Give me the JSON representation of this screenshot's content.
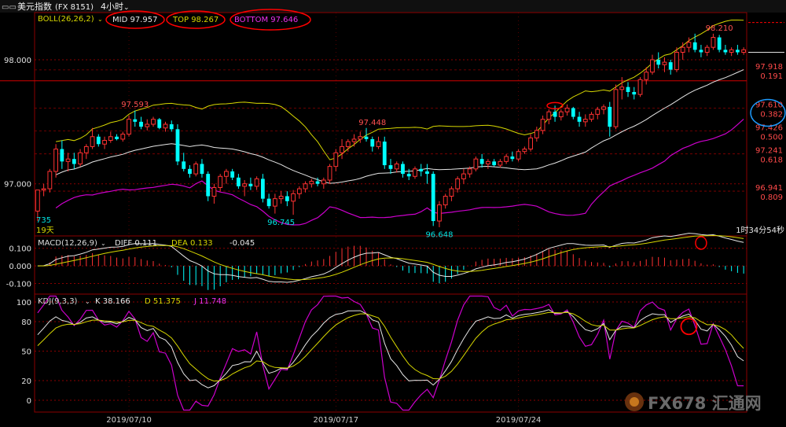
{
  "titlebar": {
    "symbol": "美元指数",
    "code": "(FX 8151)",
    "period": "4小时"
  },
  "boll": {
    "label": "BOLL(26,26,2)",
    "mid_label": "MID 97.957",
    "top_label": "TOP 98.267",
    "bottom_label": "BOTTOM 97.646"
  },
  "macd": {
    "label": "MACD(12,26,9)",
    "diff_label": "DIFF 0.111",
    "dea_label": "DEA 0.133",
    "macd_value": "-0.045"
  },
  "kdj": {
    "label": "KDJ(9,3,3)",
    "k_label": "K 38.166",
    "d_label": "D 51.375",
    "j_label": "J 11.748"
  },
  "countdown": "1时34分54秒",
  "left_marks": {
    "low_fragment": "735",
    "days": "19天"
  },
  "watermark": "FX678 汇通网",
  "colors": {
    "up": "#ff3232",
    "down": "#00ffff",
    "mid": "#e6e6e6",
    "top": "#d7d700",
    "bottom": "#cc00cc",
    "grid": "#8b0000",
    "annot": "#ff0000"
  },
  "chart_data": [
    {
      "type": "candlestick",
      "title": "美元指数 4小时",
      "y_ticks": [
        "98.000",
        "97.000"
      ],
      "y_tick_values": [
        98.0,
        97.0
      ],
      "ylim": [
        96.58,
        98.38
      ],
      "x_dates": [
        "2019/07/10",
        "2019/07/17",
        "2019/07/24"
      ],
      "fib_levels": [
        {
          "price": 97.918,
          "ratio": 0.191
        },
        {
          "price": 97.61,
          "ratio": 0.382
        },
        {
          "price": 97.426,
          "ratio": 0.5
        },
        {
          "price": 97.241,
          "ratio": 0.618
        },
        {
          "price": 96.941,
          "ratio": 0.809
        }
      ],
      "annotations": [
        {
          "text": "97.593",
          "price": 97.593
        },
        {
          "text": "96.745",
          "price": 96.745
        },
        {
          "text": "97.448",
          "price": 97.448
        },
        {
          "text": "96.648",
          "price": 96.648
        },
        {
          "text": "98.210",
          "price": 98.21
        }
      ],
      "candles": [
        [
          96.78,
          96.95,
          96.7,
          96.95
        ],
        [
          96.95,
          97.0,
          96.9,
          96.96
        ],
        [
          96.96,
          97.12,
          96.93,
          97.1
        ],
        [
          97.1,
          97.32,
          97.05,
          97.28
        ],
        [
          97.28,
          97.35,
          97.12,
          97.18
        ],
        [
          97.18,
          97.25,
          97.1,
          97.2
        ],
        [
          97.2,
          97.25,
          97.12,
          97.16
        ],
        [
          97.16,
          97.28,
          97.14,
          97.25
        ],
        [
          97.25,
          97.32,
          97.2,
          97.3
        ],
        [
          97.3,
          97.45,
          97.28,
          97.38
        ],
        [
          97.38,
          97.4,
          97.3,
          97.32
        ],
        [
          97.32,
          97.38,
          97.28,
          97.35
        ],
        [
          97.35,
          97.42,
          97.33,
          97.38
        ],
        [
          97.38,
          97.4,
          97.35,
          97.36
        ],
        [
          97.36,
          97.42,
          97.34,
          97.4
        ],
        [
          97.4,
          97.55,
          97.38,
          97.52
        ],
        [
          97.52,
          97.59,
          97.46,
          97.5
        ],
        [
          97.5,
          97.54,
          97.44,
          97.46
        ],
        [
          97.46,
          97.52,
          97.43,
          97.48
        ],
        [
          97.48,
          97.54,
          97.46,
          97.52
        ],
        [
          97.52,
          97.53,
          97.44,
          97.45
        ],
        [
          97.45,
          97.5,
          97.42,
          97.48
        ],
        [
          97.48,
          97.51,
          97.42,
          97.44
        ],
        [
          97.44,
          97.48,
          97.15,
          97.18
        ],
        [
          97.18,
          97.25,
          97.1,
          97.12
        ],
        [
          97.12,
          97.15,
          97.05,
          97.08
        ],
        [
          97.08,
          97.18,
          97.06,
          97.16
        ],
        [
          97.16,
          97.2,
          97.05,
          97.08
        ],
        [
          97.08,
          97.1,
          96.86,
          96.9
        ],
        [
          96.9,
          97.0,
          96.84,
          96.97
        ],
        [
          96.97,
          97.08,
          96.94,
          97.06
        ],
        [
          97.06,
          97.12,
          97.0,
          97.1
        ],
        [
          97.1,
          97.12,
          97.03,
          97.05
        ],
        [
          97.05,
          97.08,
          96.96,
          96.98
        ],
        [
          96.98,
          97.03,
          96.9,
          97.0
        ],
        [
          97.0,
          97.05,
          96.95,
          96.98
        ],
        [
          96.98,
          97.06,
          96.95,
          97.04
        ],
        [
          97.04,
          97.08,
          96.85,
          96.88
        ],
        [
          96.88,
          96.92,
          96.8,
          96.82
        ],
        [
          96.82,
          96.92,
          96.76,
          96.88
        ],
        [
          96.88,
          96.94,
          96.84,
          96.9
        ],
        [
          96.9,
          96.94,
          96.82,
          96.86
        ],
        [
          96.86,
          96.95,
          96.75,
          96.92
        ],
        [
          96.92,
          96.98,
          96.88,
          96.96
        ],
        [
          96.96,
          97.02,
          96.93,
          97.0
        ],
        [
          97.0,
          97.04,
          96.97,
          97.02
        ],
        [
          97.02,
          97.05,
          96.98,
          97.0
        ],
        [
          97.0,
          97.05,
          96.96,
          97.03
        ],
        [
          97.03,
          97.16,
          97.0,
          97.14
        ],
        [
          97.14,
          97.28,
          97.1,
          97.25
        ],
        [
          97.25,
          97.36,
          97.2,
          97.3
        ],
        [
          97.3,
          97.36,
          97.26,
          97.34
        ],
        [
          97.34,
          97.4,
          97.3,
          97.36
        ],
        [
          97.36,
          97.42,
          97.33,
          97.38
        ],
        [
          97.38,
          97.45,
          97.34,
          97.36
        ],
        [
          97.36,
          97.38,
          97.26,
          97.3
        ],
        [
          97.3,
          97.38,
          97.28,
          97.34
        ],
        [
          97.34,
          97.38,
          97.12,
          97.15
        ],
        [
          97.15,
          97.2,
          97.08,
          97.12
        ],
        [
          97.12,
          97.18,
          97.09,
          97.16
        ],
        [
          97.16,
          97.18,
          97.05,
          97.08
        ],
        [
          97.08,
          97.12,
          97.03,
          97.06
        ],
        [
          97.06,
          97.14,
          97.04,
          97.12
        ],
        [
          97.12,
          97.16,
          97.06,
          97.1
        ],
        [
          97.1,
          97.16,
          97.0,
          97.08
        ],
        [
          97.08,
          97.1,
          96.66,
          96.7
        ],
        [
          96.7,
          96.86,
          96.65,
          96.83
        ],
        [
          96.83,
          96.92,
          96.8,
          96.9
        ],
        [
          96.9,
          96.98,
          96.86,
          96.96
        ],
        [
          96.96,
          97.06,
          96.93,
          97.04
        ],
        [
          97.04,
          97.12,
          97.0,
          97.08
        ],
        [
          97.08,
          97.14,
          97.05,
          97.12
        ],
        [
          97.12,
          97.22,
          97.1,
          97.2
        ],
        [
          97.2,
          97.24,
          97.13,
          97.16
        ],
        [
          97.16,
          97.2,
          97.12,
          97.18
        ],
        [
          97.18,
          97.2,
          97.14,
          97.15
        ],
        [
          97.15,
          97.2,
          97.13,
          97.18
        ],
        [
          97.18,
          97.24,
          97.16,
          97.22
        ],
        [
          97.22,
          97.26,
          97.18,
          97.2
        ],
        [
          97.2,
          97.28,
          97.18,
          97.26
        ],
        [
          97.26,
          97.3,
          97.24,
          97.28
        ],
        [
          97.28,
          97.4,
          97.26,
          97.37
        ],
        [
          97.37,
          97.46,
          97.34,
          97.43
        ],
        [
          97.43,
          97.55,
          97.4,
          97.52
        ],
        [
          97.52,
          97.6,
          97.48,
          97.58
        ],
        [
          97.58,
          97.63,
          97.5,
          97.54
        ],
        [
          97.54,
          97.6,
          97.51,
          97.58
        ],
        [
          97.58,
          97.64,
          97.55,
          97.61
        ],
        [
          97.61,
          97.62,
          97.52,
          97.54
        ],
        [
          97.54,
          97.58,
          97.46,
          97.5
        ],
        [
          97.5,
          97.56,
          97.46,
          97.52
        ],
        [
          97.52,
          97.58,
          97.5,
          97.56
        ],
        [
          97.56,
          97.62,
          97.52,
          97.6
        ],
        [
          97.6,
          97.64,
          97.56,
          97.62
        ],
        [
          97.62,
          97.66,
          97.38,
          97.46
        ],
        [
          97.46,
          97.8,
          97.44,
          97.76
        ],
        [
          97.76,
          97.86,
          97.68,
          97.78
        ],
        [
          97.78,
          97.82,
          97.7,
          97.74
        ],
        [
          97.74,
          97.78,
          97.68,
          97.72
        ],
        [
          97.72,
          97.86,
          97.7,
          97.84
        ],
        [
          97.84,
          97.94,
          97.8,
          97.9
        ],
        [
          97.9,
          98.04,
          97.88,
          98.0
        ],
        [
          98.0,
          98.06,
          97.93,
          97.96
        ],
        [
          97.96,
          98.02,
          97.9,
          97.98
        ],
        [
          97.98,
          98.0,
          97.88,
          97.92
        ],
        [
          97.92,
          98.1,
          97.9,
          98.06
        ],
        [
          98.06,
          98.14,
          98.0,
          98.1
        ],
        [
          98.1,
          98.18,
          98.06,
          98.14
        ],
        [
          98.14,
          98.21,
          98.06,
          98.08
        ],
        [
          98.08,
          98.12,
          98.02,
          98.06
        ],
        [
          98.06,
          98.12,
          98.03,
          98.1
        ],
        [
          98.1,
          98.21,
          98.08,
          98.18
        ],
        [
          98.18,
          98.2,
          98.06,
          98.08
        ],
        [
          98.08,
          98.12,
          98.04,
          98.06
        ],
        [
          98.06,
          98.1,
          98.03,
          98.08
        ],
        [
          98.08,
          98.12,
          98.04,
          98.06
        ],
        [
          98.06,
          98.1,
          98.04,
          98.08
        ]
      ]
    },
    {
      "type": "line",
      "title": "MACD(12,26,9)",
      "y_ticks": [
        "0.100",
        "0.000",
        "-0.100"
      ],
      "y_tick_values": [
        0.1,
        0.0,
        -0.1
      ],
      "ylim": [
        -0.16,
        0.17
      ],
      "series": [
        {
          "name": "DIFF",
          "last": 0.111
        },
        {
          "name": "DEA",
          "last": 0.133
        },
        {
          "name": "MACD",
          "last": -0.045
        }
      ]
    },
    {
      "type": "line",
      "title": "KDJ(9,3,3)",
      "y_ticks": [
        "100",
        "80",
        "50",
        "20",
        "0"
      ],
      "y_tick_values": [
        100,
        80,
        50,
        20,
        0
      ],
      "ylim": [
        -12,
        108
      ],
      "series": [
        {
          "name": "K",
          "last": 38.166
        },
        {
          "name": "D",
          "last": 51.375
        },
        {
          "name": "J",
          "last": 11.748
        }
      ]
    }
  ]
}
